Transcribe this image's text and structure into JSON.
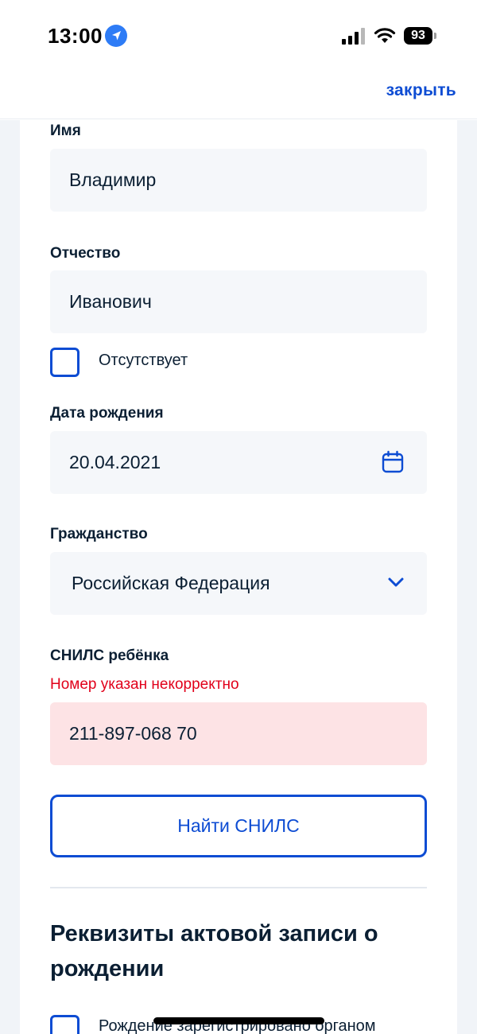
{
  "status_bar": {
    "time": "13:00",
    "battery": "93",
    "icons": [
      "location-arrow-icon",
      "signal-icon",
      "wifi-icon",
      "battery-icon"
    ]
  },
  "header": {
    "close_label": "закрыть"
  },
  "form": {
    "first_name": {
      "label": "Имя",
      "value": "Владимир"
    },
    "patronymic": {
      "label": "Отчество",
      "value": "Иванович",
      "absent_label": "Отсутствует",
      "absent_checked": false
    },
    "birth_date": {
      "label": "Дата рождения",
      "value": "20.04.2021",
      "icon": "calendar-icon"
    },
    "citizenship": {
      "label": "Гражданство",
      "value": "Российская Федерация",
      "icon": "chevron-down-icon"
    },
    "snils": {
      "label": "СНИЛС ребёнка",
      "error": "Номер указан некорректно",
      "value": "211-897-068 70"
    },
    "find_snils_button": "Найти СНИЛС"
  },
  "section": {
    "title": "Реквизиты актовой записи о рождении",
    "checkbox_label": "Рождение зарегистрировано органом"
  },
  "colors": {
    "accent": "#0d4cd3",
    "error": "#e1001a",
    "error_bg": "#fde3e5",
    "field_bg": "#f5f7fa",
    "page_bg": "#f1f4f8"
  }
}
